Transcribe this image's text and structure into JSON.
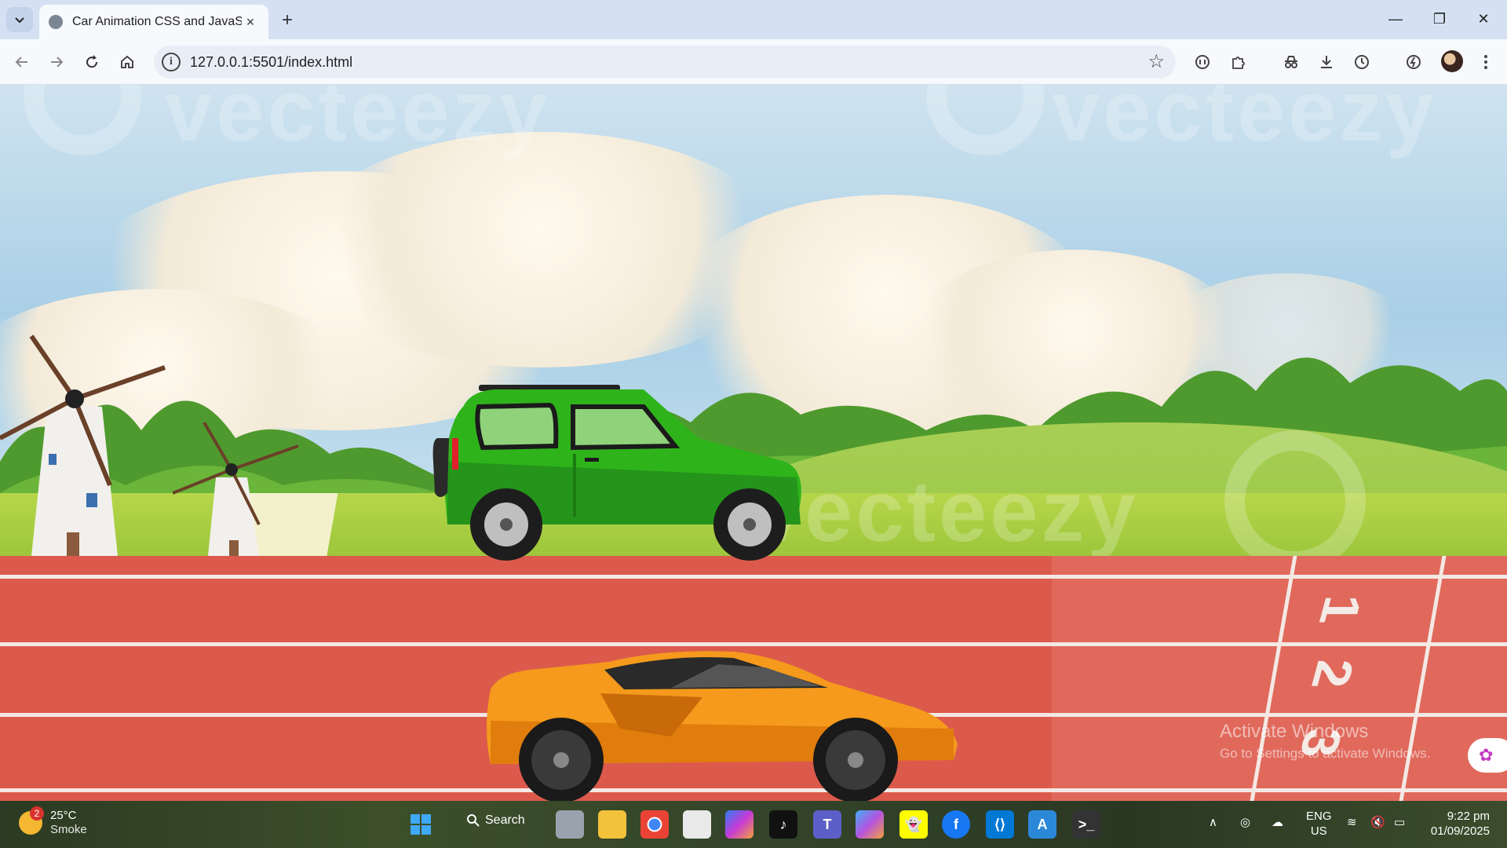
{
  "browser": {
    "tab_title": "Car Animation CSS and JavaScri",
    "url": "127.0.0.1:5501/index.html",
    "new_tab_symbol": "+",
    "tab_close_symbol": "×"
  },
  "window_controls": {
    "minimize": "—",
    "restore": "❐",
    "close": "✕"
  },
  "page": {
    "watermark_text": "vecteezy",
    "lane_numbers": [
      "1",
      "2",
      "3"
    ],
    "activate_title": "Activate Windows",
    "activate_subtitle": "Go to Settings to activate Windows."
  },
  "taskbar": {
    "weather_badge": "2",
    "temperature": "25°C",
    "condition": "Smoke",
    "search_label": "Search",
    "language_line1": "ENG",
    "language_line2": "US",
    "time": "9:22 pm",
    "date": "01/09/2025"
  },
  "colors": {
    "jeep_body": "#2fb31b",
    "sports_car_body": "#f59a1c",
    "track": "#dc5a4c"
  }
}
